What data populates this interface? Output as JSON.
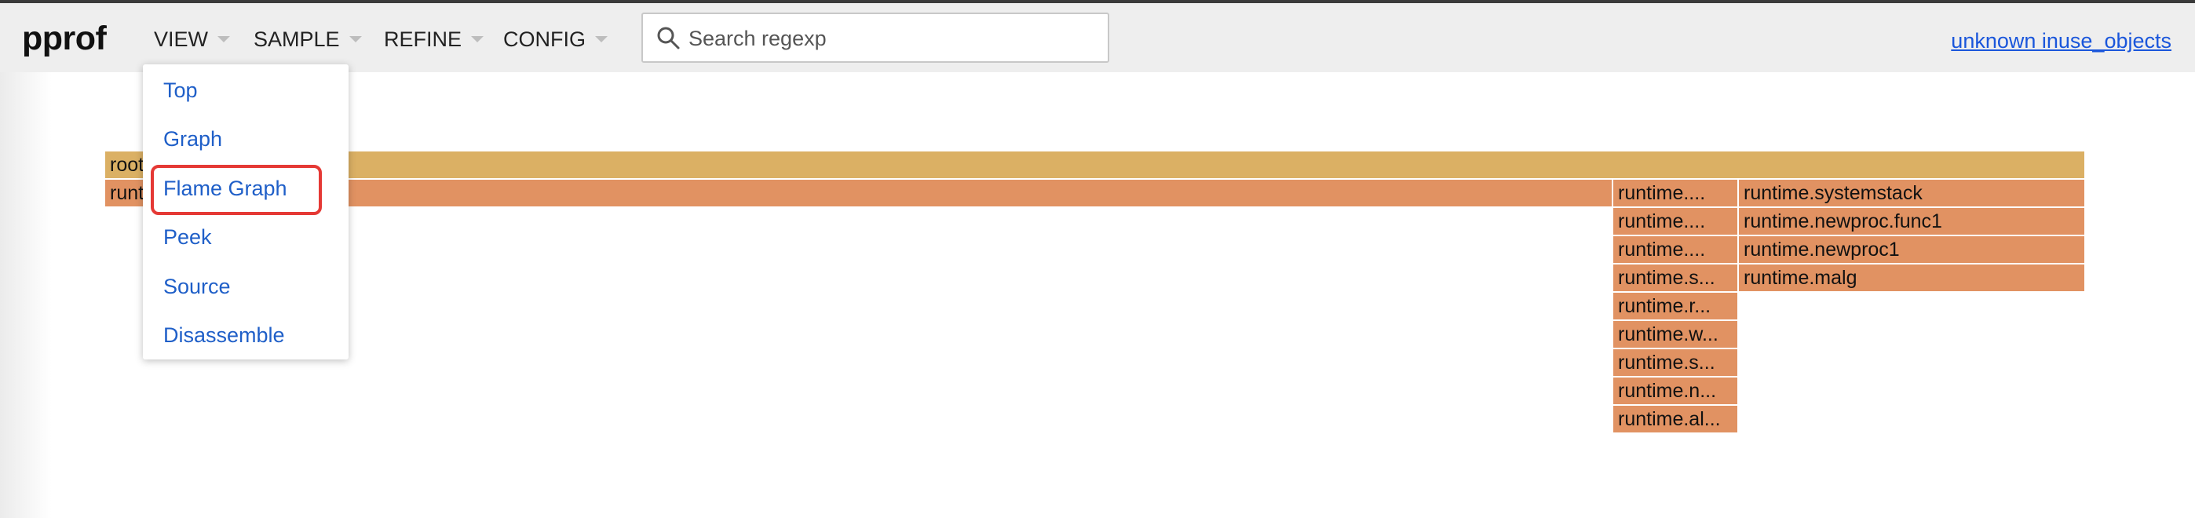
{
  "app": {
    "logo": "pprof"
  },
  "menus": [
    {
      "label": "VIEW"
    },
    {
      "label": "SAMPLE"
    },
    {
      "label": "REFINE"
    },
    {
      "label": "CONFIG"
    }
  ],
  "search": {
    "placeholder": "Search regexp",
    "value": ""
  },
  "profile_link": "unknown inuse_objects",
  "view_menu": {
    "items": [
      "Top",
      "Graph",
      "Flame Graph",
      "Peek",
      "Source",
      "Disassemble"
    ],
    "highlighted": "Flame Graph"
  },
  "flame": {
    "root": "root",
    "level1_left": "runtime.main",
    "column_a": [
      "runtime....",
      "runtime....",
      "runtime....",
      "runtime.s...",
      "runtime.r...",
      "runtime.w...",
      "runtime.s...",
      "runtime.n...",
      "runtime.al..."
    ],
    "column_b": [
      "runtime.systemstack",
      "runtime.newproc.func1",
      "runtime.newproc1",
      "runtime.malg"
    ]
  },
  "colors": {
    "root_frame": "#dbb064",
    "frame": "#e19262",
    "header": "#eeeeee",
    "link": "#1a56db",
    "menu_item": "#1f5fc8",
    "highlight": "#e53935"
  }
}
